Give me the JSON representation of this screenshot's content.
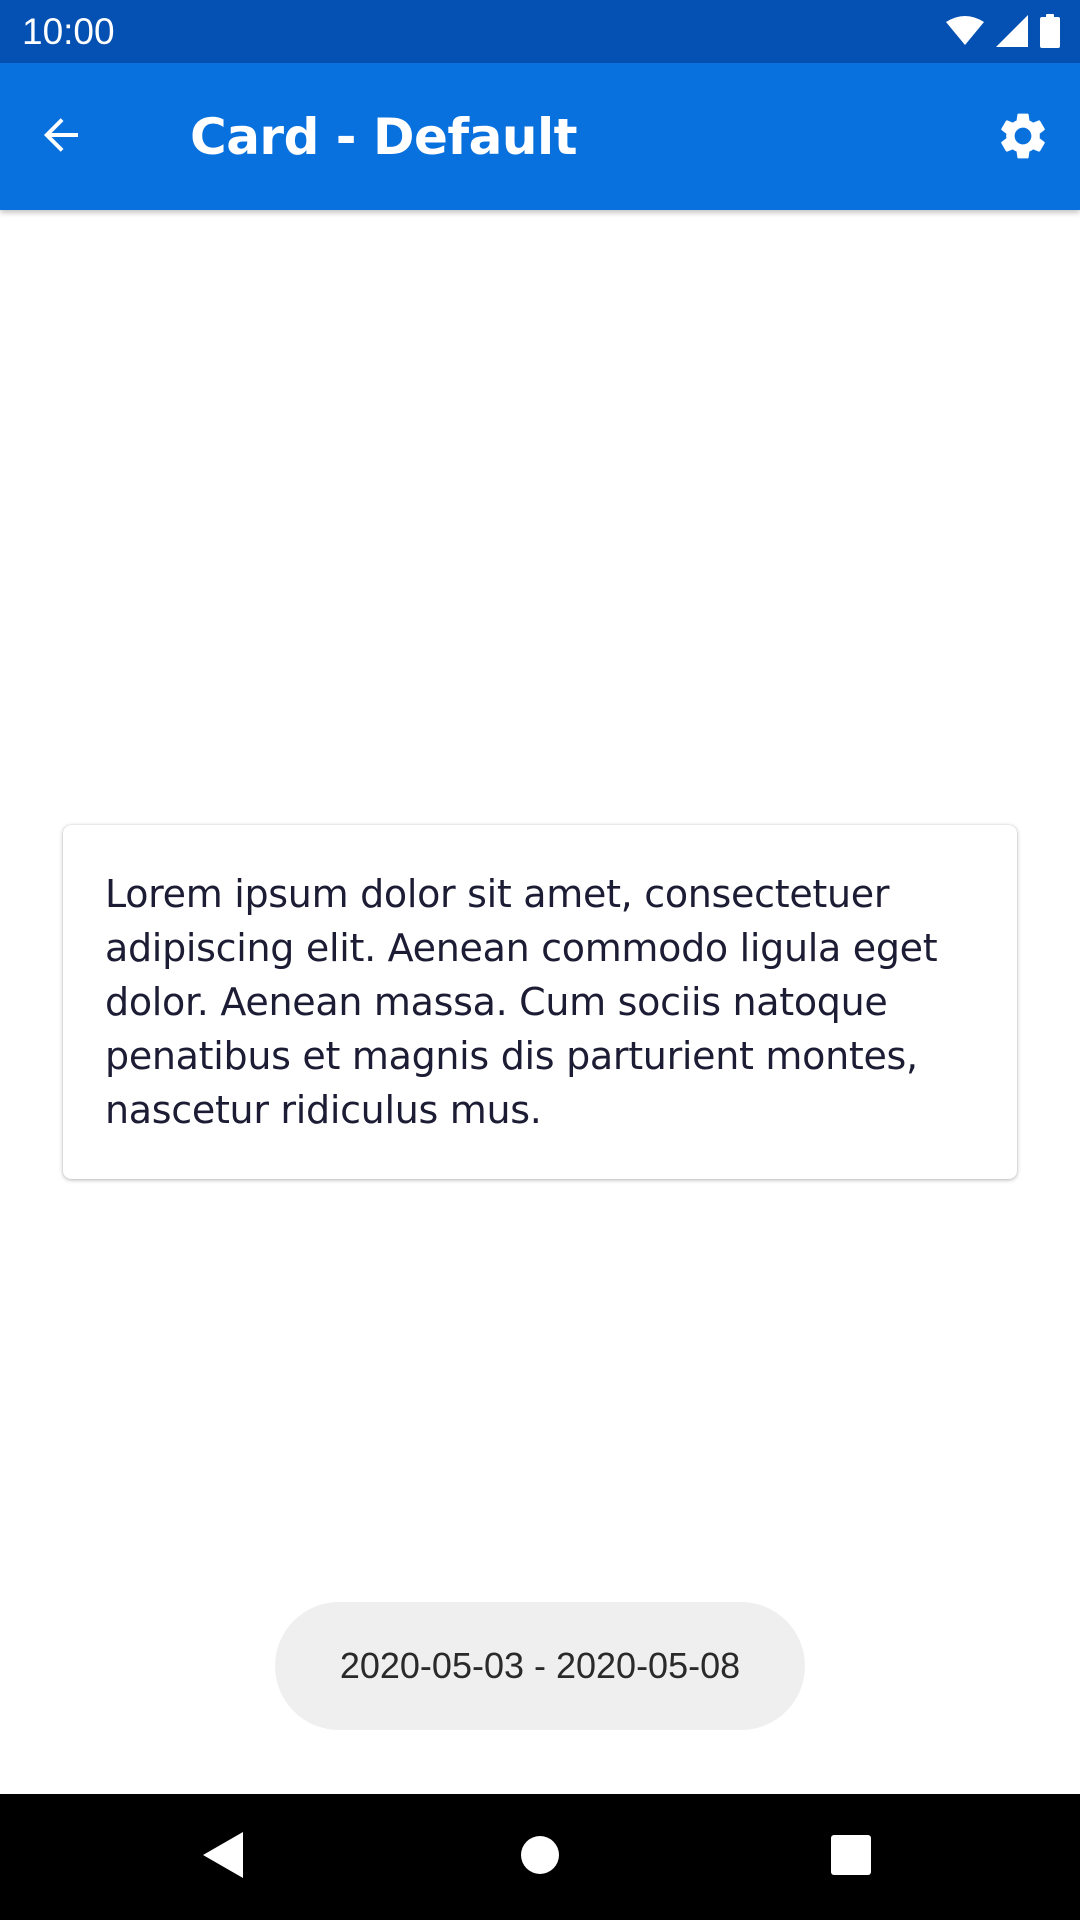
{
  "status_bar": {
    "time": "10:00",
    "icons": [
      "wifi-icon",
      "cell-signal-icon",
      "battery-icon"
    ]
  },
  "app_bar": {
    "title": "Card - Default",
    "back_icon": "arrow-back-icon",
    "settings_icon": "gear-icon",
    "color": "#0971de"
  },
  "card": {
    "text": "Lorem ipsum dolor sit amet, consectetuer adipiscing elit. Aenean commodo ligula eget dolor. Aenean massa. Cum sociis natoque penatibus et magnis dis parturient montes, nascetur ridiculus mus."
  },
  "date_chip": {
    "label": "2020-05-03 - 2020-05-08"
  },
  "nav_bar": {
    "buttons": [
      "nav-back-icon",
      "nav-home-icon",
      "nav-recents-icon"
    ]
  },
  "colors": {
    "status_bar": "#0550b3",
    "app_bar": "#0971de",
    "text": "#1c1c34",
    "chip_bg": "#efefef"
  }
}
